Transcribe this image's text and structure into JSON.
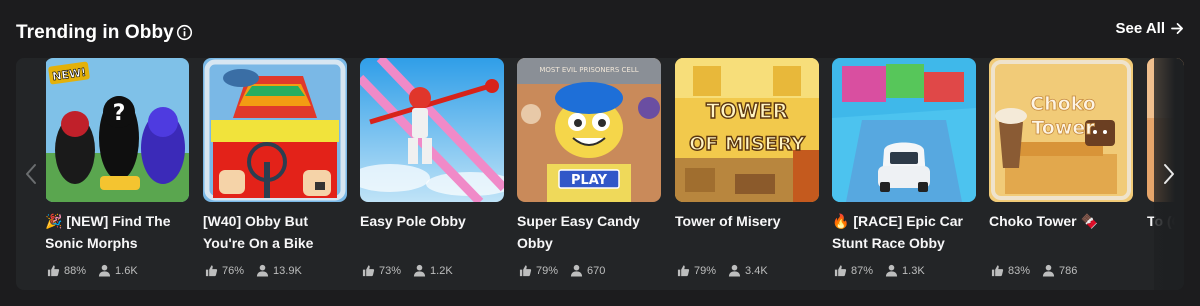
{
  "section": {
    "title": "Trending in Obby",
    "see_all_label": "See All"
  },
  "colors": {
    "background": "#1c1c1e",
    "card_background": "#232527",
    "stat_text": "#bdbebe"
  },
  "icons": {
    "info": "info-circle-icon",
    "see_all": "arrow-right-icon",
    "like": "thumbs-up-icon",
    "players": "person-icon",
    "prev": "chevron-left-icon",
    "next": "chevron-right-icon"
  },
  "games": [
    {
      "name": "🎉 [NEW] Find The Sonic Morphs",
      "rating": "88%",
      "players": "1.6K",
      "badge": "NEW!"
    },
    {
      "name": "[W40] Obby But You're On a Bike",
      "rating": "76%",
      "players": "13.9K"
    },
    {
      "name": "Easy Pole Obby",
      "rating": "73%",
      "players": "1.2K"
    },
    {
      "name": "Super Easy Candy Obby",
      "rating": "79%",
      "players": "670",
      "thumb_text": "PLAY",
      "thumb_caption": "MOST EVIL PRISONERS CELL"
    },
    {
      "name": "Tower of Misery",
      "rating": "79%",
      "players": "3.4K",
      "thumb_text": "TOWER OF MISERY"
    },
    {
      "name": "🔥 [RACE] Epic Car Stunt Race Obby",
      "rating": "87%",
      "players": "1.3K"
    },
    {
      "name": "Choko Tower 🍫",
      "rating": "83%",
      "players": "786",
      "thumb_text": "Choko Tower"
    },
    {
      "name": "To (C",
      "rating": "",
      "players": ""
    }
  ]
}
